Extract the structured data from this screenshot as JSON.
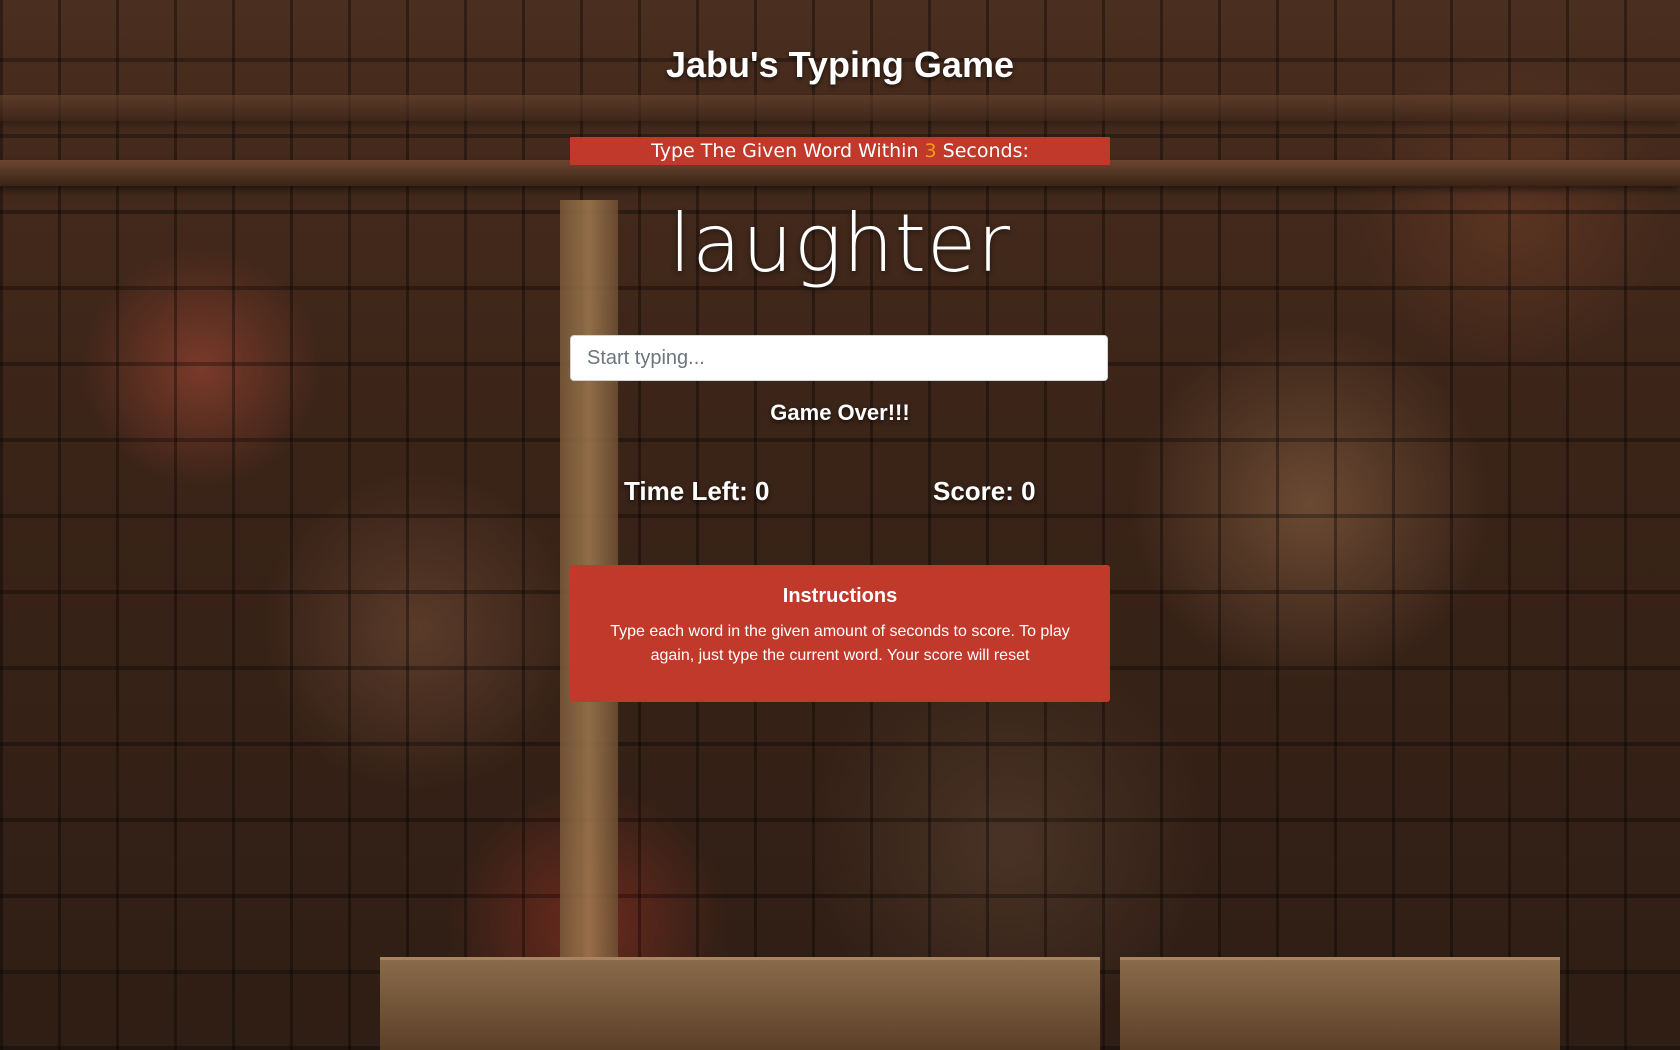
{
  "app": {
    "title": "Jabu's Typing Game"
  },
  "banner": {
    "prefix": "Type The Given Word Within ",
    "seconds": "3",
    "suffix": " Seconds:"
  },
  "current_word": "laughter",
  "input": {
    "placeholder": "Start typing...",
    "value": ""
  },
  "message": "Game Over!!!",
  "stats": {
    "time_left": "Time Left: 0",
    "score": "Score: 0"
  },
  "instructions": {
    "heading": "Instructions",
    "body": "Type each word in the given amount of seconds to score. To play again, just type the current word. Your score will reset"
  },
  "colors": {
    "accent": "#c0392b",
    "seconds_highlight": "#f39c12",
    "text": "#ffffff"
  }
}
